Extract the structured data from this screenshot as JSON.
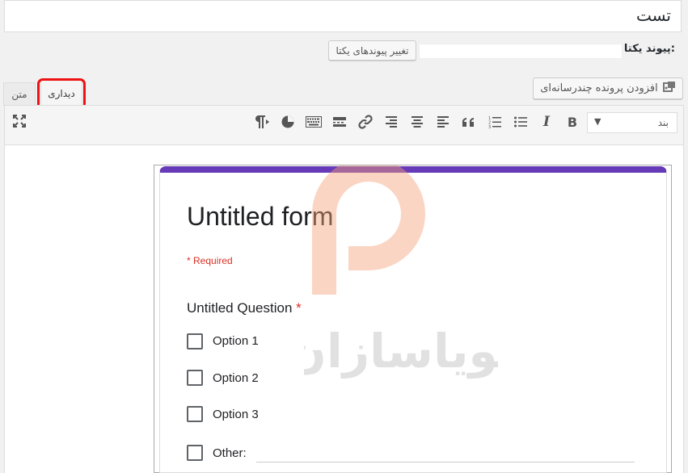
{
  "post": {
    "title": "تست",
    "permalink_label": "پیوند یکتا:",
    "change_permalink_button": "تغییر پیوندهای یکتا"
  },
  "media": {
    "add_media_button": "افزودن پرونده چندرسانه‌ای"
  },
  "tabs": {
    "text": "متن",
    "visual": "دیداری",
    "active": "visual"
  },
  "toolbar": {
    "paragraph_select": "بند",
    "icons": [
      "bold-icon",
      "italic-icon",
      "bulleted-list-icon",
      "numbered-list-icon",
      "blockquote-icon",
      "align-left-icon",
      "align-center-icon",
      "align-right-icon",
      "link-icon",
      "read-more-icon",
      "toolbar-toggle-icon",
      "form-embed-icon",
      "paragraph-direction-icon",
      "fullscreen-icon"
    ]
  },
  "form": {
    "accent_color": "#673ab7",
    "title": "Untitled form",
    "required_note": "* Required",
    "question": {
      "text": "Untitled Question",
      "required_mark": "*"
    },
    "options": [
      {
        "label": "Option 1"
      },
      {
        "label": "Option 2"
      },
      {
        "label": "Option 3"
      },
      {
        "label": "Other:"
      }
    ]
  },
  "watermark": {
    "brand": "پویاسازان"
  },
  "colors": {
    "highlight": "#e11",
    "required": "#d93025"
  }
}
